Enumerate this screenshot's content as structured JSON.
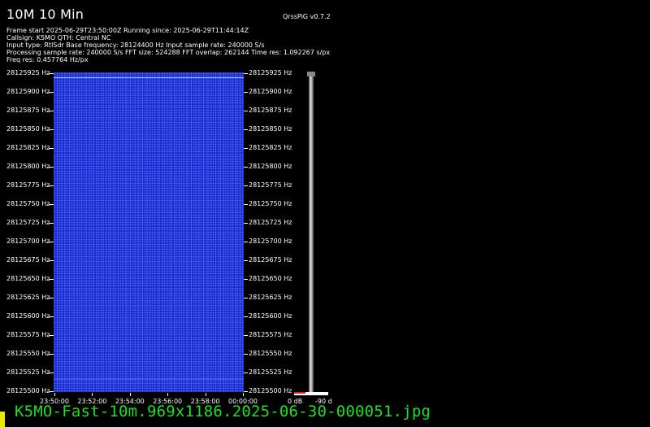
{
  "header": {
    "title": "10M 10 Min",
    "version": "QrssPiG v0.7.2",
    "info_lines": [
      "Frame start 2025-06-29T23:50:00Z Running since: 2025-06-29T11:44:14Z",
      "Callsign: K5MO QTH: Central NC",
      "Input type: RtlSdr Base frequency: 28124400 Hz Input sample rate: 240000 S/s",
      "Processing sample rate: 240000 S/s FFT size: 524288 FFT overlap: 262144 Time res: 1.092267 s/px",
      "Freq res: 0.457764 Hz/px"
    ]
  },
  "spectrogram": {
    "freq_labels": [
      "28125925 Hz",
      "28125900 Hz",
      "28125875 Hz",
      "28125850 Hz",
      "28125825 Hz",
      "28125800 Hz",
      "28125775 Hz",
      "28125750 Hz",
      "28125725 Hz",
      "28125700 Hz",
      "28125675 Hz",
      "28125650 Hz",
      "28125625 Hz",
      "28125600 Hz",
      "28125575 Hz",
      "28125550 Hz",
      "28125525 Hz",
      "28125500 Hz"
    ],
    "time_labels": [
      "23:50:00",
      "23:52:00",
      "23:54:00",
      "23:56:00",
      "23:58:00",
      "00:00:00"
    ],
    "colors": {
      "background": "#1a2fd8",
      "signal_line": "#aab6ff"
    }
  },
  "colorbar": {
    "min_label": "0 dB",
    "max_label": "-90 d"
  },
  "footer": {
    "filename": "K5MO-Fast-10m.969x1186.2025-06-30-000051.jpg",
    "color": "#22dd22"
  }
}
